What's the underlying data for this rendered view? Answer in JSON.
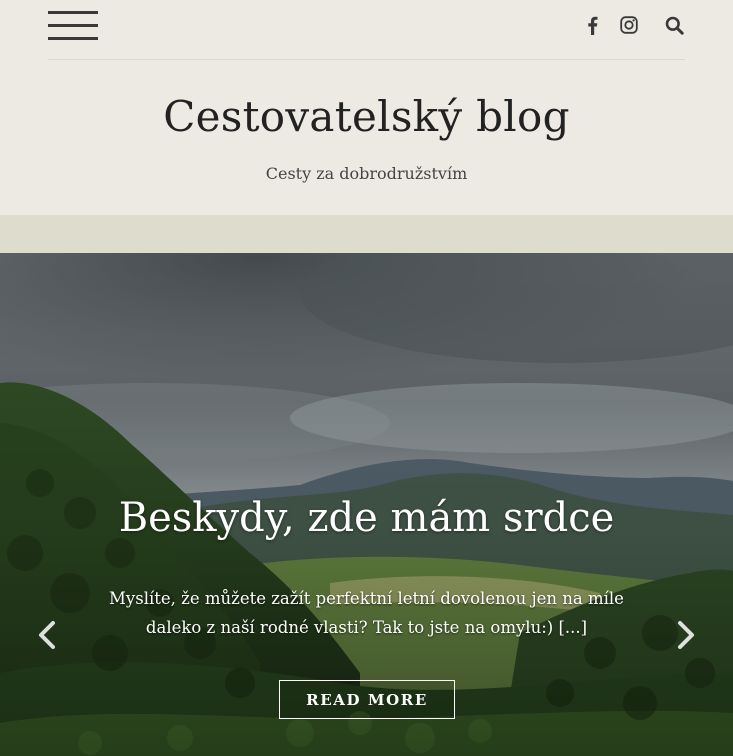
{
  "header": {
    "menu_icon": "hamburger-menu-icon",
    "social_icons": [
      "facebook-icon",
      "instagram-icon"
    ],
    "search_icon": "search-icon",
    "site_title": "Cestovatelský blog",
    "tagline": "Cesty za dobrodružstvím"
  },
  "slider": {
    "title": "Beskydy, zde mám srdce",
    "excerpt": "Myslíte, že můžete zažít perfektní letní dovolenou jen na míle daleko z naší rodné vlasti? Tak to jste na omylu:) [...]",
    "read_more_label": "Read More",
    "prev_icon": "chevron-left-icon",
    "next_icon": "chevron-right-icon",
    "image": "mountain-forest-landscape"
  },
  "colors": {
    "header_bg": "#eceae2",
    "band_bg": "#dedccd",
    "text_dark": "#222222",
    "icon_gray": "#3a3a3a"
  }
}
